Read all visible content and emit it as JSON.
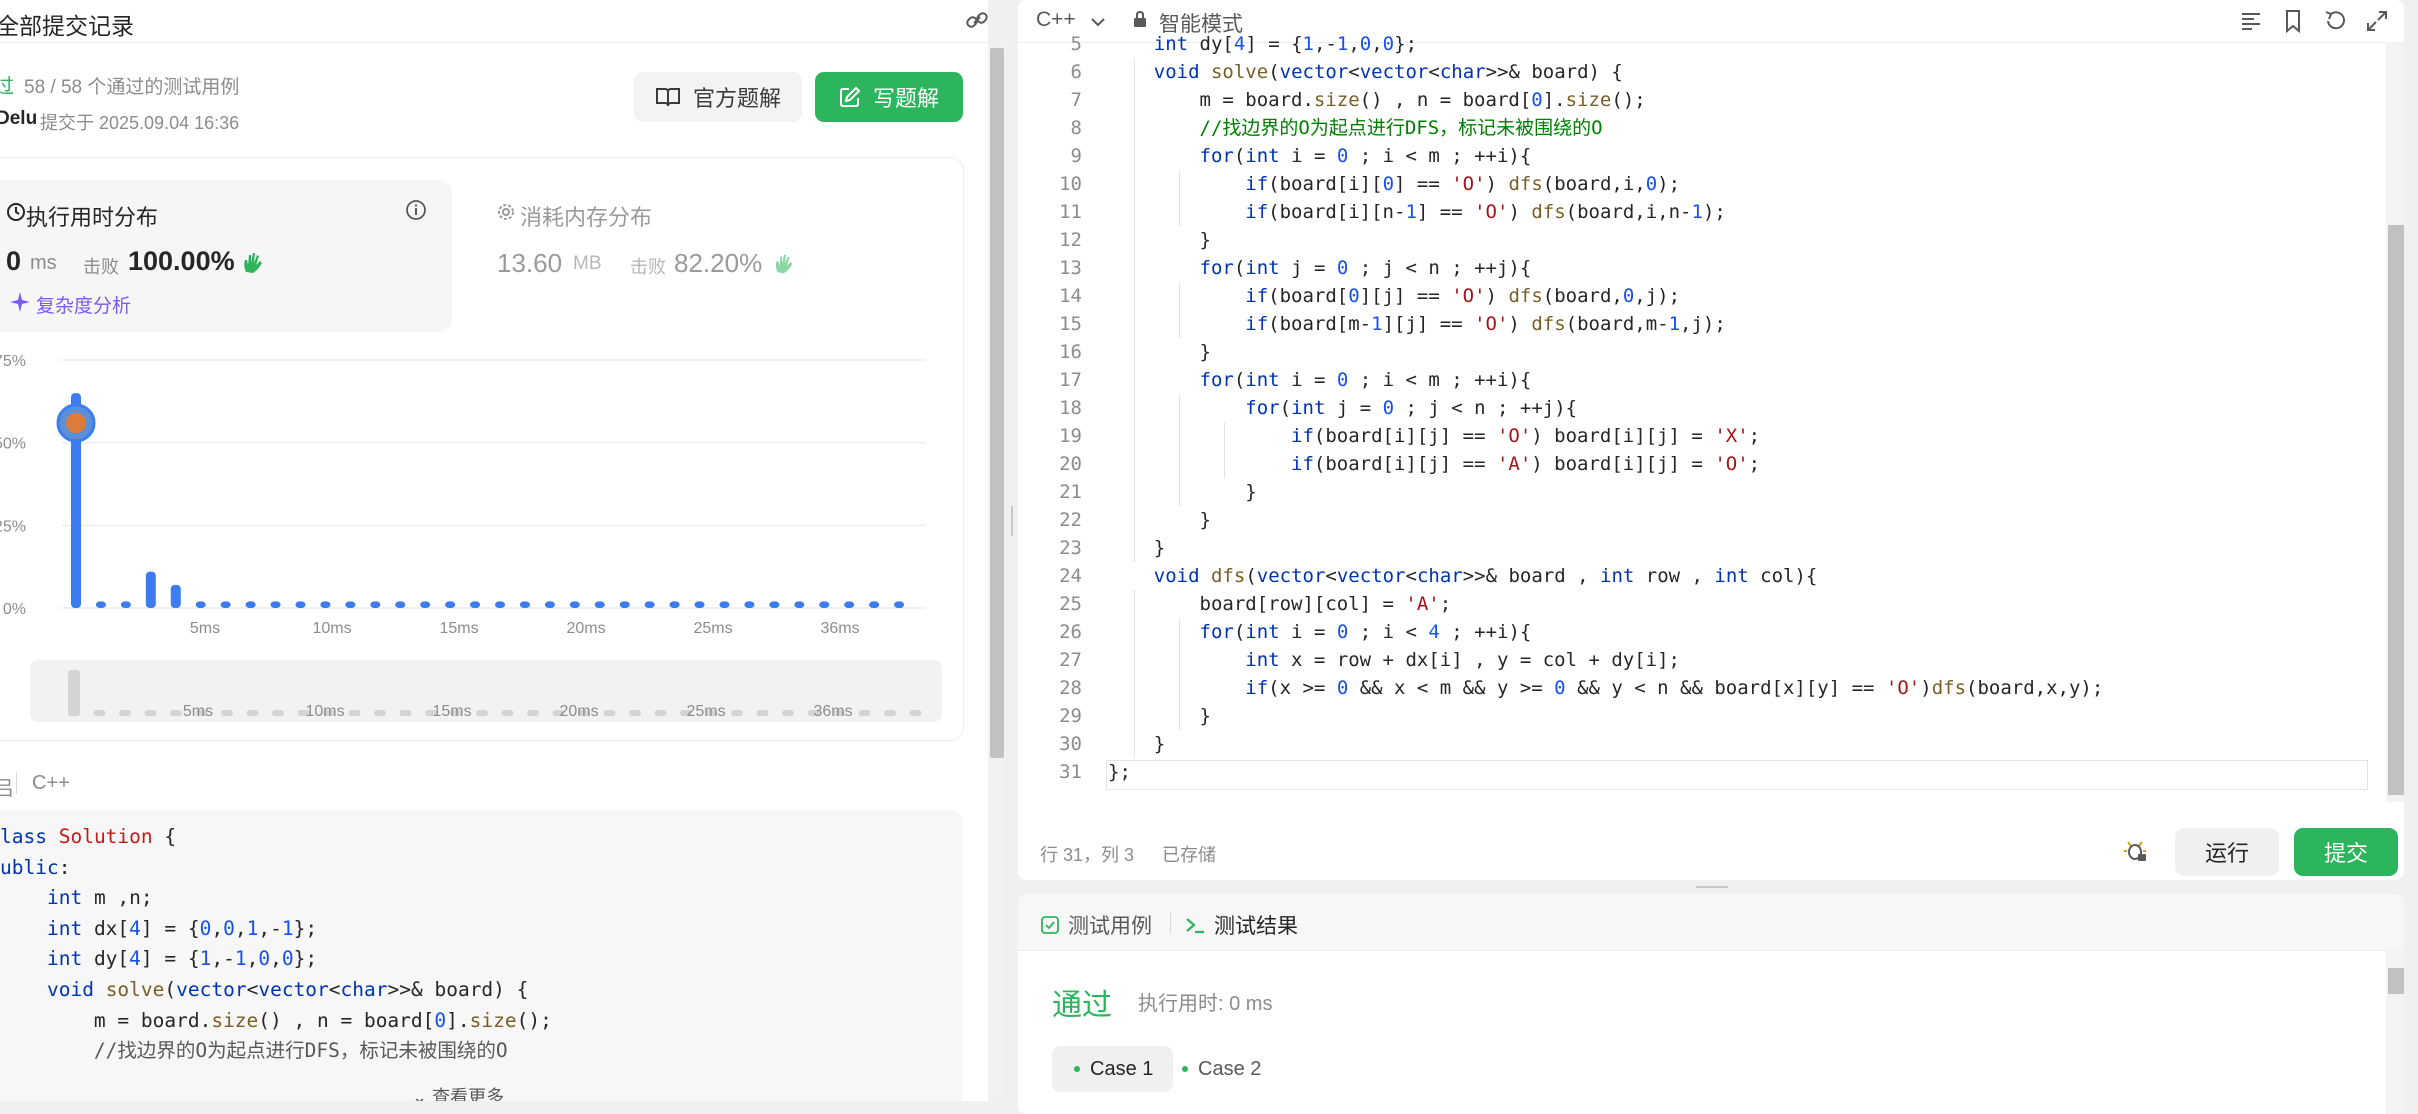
{
  "left_panel": {
    "title": "全部提交记录",
    "status": "过",
    "cases_passed": "58 / 58 个通过的测试用例",
    "user": "Delu",
    "submitted_at": "提交于 2025.09.04 16:36",
    "btn_official": "官方题解",
    "btn_write": "写题解",
    "runtime": {
      "title": "执行用时分布",
      "value": "0",
      "unit": "ms",
      "beat_label": "击败",
      "percent": "100.00%",
      "complexity": "复杂度分析"
    },
    "memory": {
      "title": "消耗内存分布",
      "value": "13.60",
      "unit": "MB",
      "beat_label": "击败",
      "percent": "82.20%"
    },
    "lang_prefix": "吕",
    "language": "C++",
    "view_more": "查看更多",
    "code_lines": [
      "lass Solution {",
      "ublic:",
      "    int m ,n;",
      "    int dx[4] = {0,0,1,-1};",
      "    int dy[4] = {1,-1,0,0};",
      "    void solve(vector<vector<char>>& board) {",
      "        m = board.size() , n = board[0].size();",
      "        //找边界的O为起点进行DFS，标记未被围绕的O"
    ]
  },
  "chart_data": {
    "type": "bar",
    "title": "",
    "xlabel": "",
    "ylabel": "",
    "ylim": [
      0,
      75
    ],
    "yticks": [
      "75%",
      "50%",
      "25%",
      "0%"
    ],
    "xticks": [
      "5ms",
      "10ms",
      "15ms",
      "20ms",
      "25ms",
      "36ms"
    ],
    "mini_xticks": [
      "5ms",
      "10ms",
      "15ms",
      "20ms",
      "25ms",
      "36ms"
    ],
    "values": [
      65,
      2,
      2,
      11,
      7,
      2,
      2,
      2,
      2,
      2,
      2,
      2,
      2,
      2,
      2,
      2,
      2,
      2,
      2,
      2,
      2,
      2,
      2,
      2,
      2,
      2,
      2,
      2,
      2,
      2,
      2,
      2,
      2,
      2
    ],
    "highlight_index": 0,
    "grid": true,
    "bar_color": "#3b7cf1"
  },
  "editor": {
    "language": "C++",
    "mode": "智能模式",
    "cursor_pos": "行 31，列 3",
    "saved": "已存储",
    "run": "运行",
    "submit": "提交",
    "lines": [
      {
        "n": "5",
        "t": "    int dy[4] = {1,-1,0,0};"
      },
      {
        "n": "6",
        "t": "    void solve(vector<vector<char>>& board) {"
      },
      {
        "n": "7",
        "t": "        m = board.size() , n = board[0].size();"
      },
      {
        "n": "8",
        "t": "        //找边界的O为起点进行DFS，标记未被围绕的O"
      },
      {
        "n": "9",
        "t": "        for(int i = 0 ; i < m ; ++i){"
      },
      {
        "n": "10",
        "t": "            if(board[i][0] == 'O') dfs(board,i,0);"
      },
      {
        "n": "11",
        "t": "            if(board[i][n-1] == 'O') dfs(board,i,n-1);"
      },
      {
        "n": "12",
        "t": "        }"
      },
      {
        "n": "13",
        "t": "        for(int j = 0 ; j < n ; ++j){"
      },
      {
        "n": "14",
        "t": "            if(board[0][j] == 'O') dfs(board,0,j);"
      },
      {
        "n": "15",
        "t": "            if(board[m-1][j] == 'O') dfs(board,m-1,j);"
      },
      {
        "n": "16",
        "t": "        }"
      },
      {
        "n": "17",
        "t": "        for(int i = 0 ; i < m ; ++i){"
      },
      {
        "n": "18",
        "t": "            for(int j = 0 ; j < n ; ++j){"
      },
      {
        "n": "19",
        "t": "                if(board[i][j] == 'O') board[i][j] = 'X';"
      },
      {
        "n": "20",
        "t": "                if(board[i][j] == 'A') board[i][j] = 'O';"
      },
      {
        "n": "21",
        "t": "            }"
      },
      {
        "n": "22",
        "t": "        }"
      },
      {
        "n": "23",
        "t": "    }"
      },
      {
        "n": "24",
        "t": "    void dfs(vector<vector<char>>& board , int row , int col){"
      },
      {
        "n": "25",
        "t": "        board[row][col] = 'A';"
      },
      {
        "n": "26",
        "t": "        for(int i = 0 ; i < 4 ; ++i){"
      },
      {
        "n": "27",
        "t": "            int x = row + dx[i] , y = col + dy[i];"
      },
      {
        "n": "28",
        "t": "            if(x >= 0 && x < m && y >= 0 && y < n && board[x][y] == 'O')dfs(board,x,y);"
      },
      {
        "n": "29",
        "t": "        }"
      },
      {
        "n": "30",
        "t": "    }"
      },
      {
        "n": "31",
        "t": "};"
      }
    ]
  },
  "result": {
    "tab_cases": "测试用例",
    "tab_result": "测试结果",
    "status": "通过",
    "runtime": "执行用时: 0 ms",
    "case1": "Case 1",
    "case2": "Case 2"
  },
  "colors": {
    "accent_green": "#2db55d",
    "bar_blue": "#3b7cf1",
    "purple": "#7a5af8"
  }
}
